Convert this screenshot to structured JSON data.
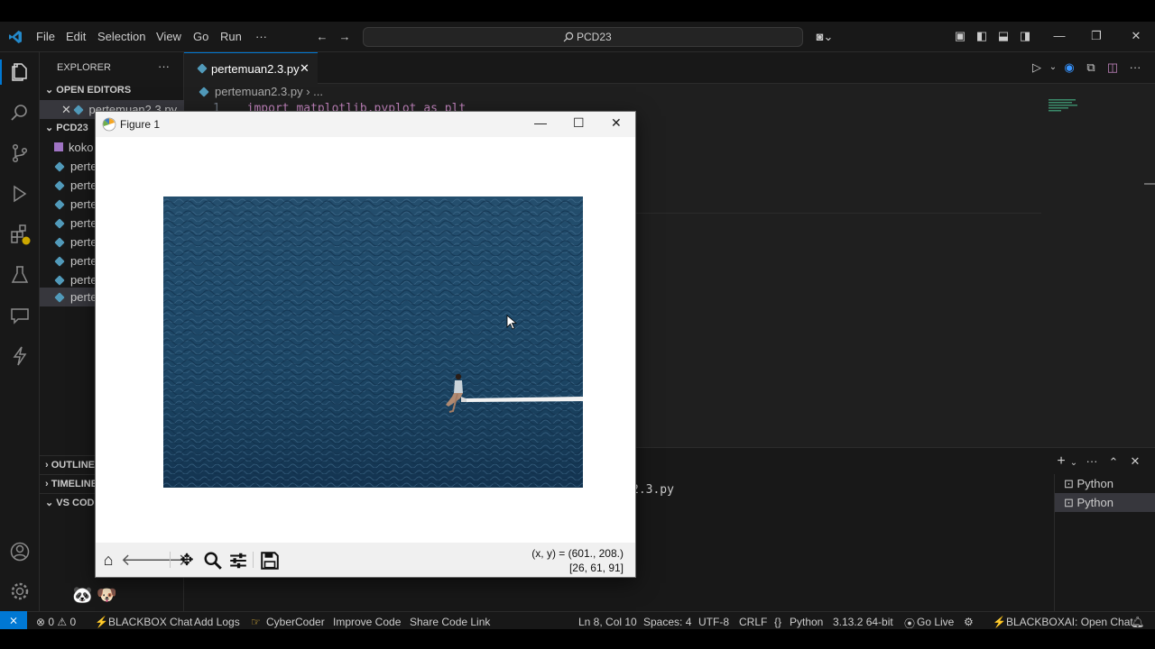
{
  "menu": {
    "items": [
      "File",
      "Edit",
      "Selection",
      "View",
      "Go",
      "Run",
      "···"
    ],
    "search_text": "PCD23"
  },
  "sidebar": {
    "title": "EXPLORER",
    "more": "···",
    "open_editors_label": "OPEN EDITORS",
    "open_editor_file": "pertemuan2.3.py",
    "folder_label": "PCD23",
    "files": [
      "koko",
      "perte",
      "perte",
      "perte",
      "perte",
      "perte",
      "perte",
      "perte",
      "perte"
    ],
    "outline_label": "OUTLINE",
    "timeline_label": "TIMELINE",
    "vscode_label": "VS CODE"
  },
  "editor": {
    "tab_label": "pertemuan2.3.py",
    "breadcrumb_file": "pertemuan2.3.py",
    "breadcrumb_more": "...",
    "line_number": "1",
    "code_line": "import matplotlib.pyplot as plt"
  },
  "panel": {
    "terminal_fragment": "2.3.py",
    "terminals": [
      "Python",
      "Python"
    ]
  },
  "figure": {
    "title": "Figure 1",
    "coord_line1": "(x, y) = (601., 208.)",
    "coord_line2": "[26, 61, 91]"
  },
  "status": {
    "remote": "⨯",
    "problems": "⊗ 0 ⚠ 0",
    "blackbox_chat": "BLACKBOX Chat",
    "add_logs": "Add Logs",
    "cybercoder": "CyberCoder",
    "improve_code": "Improve Code",
    "share_code_link": "Share Code Link",
    "position": "Ln 8, Col 10",
    "spaces": "Spaces: 4",
    "encoding": "UTF-8",
    "eol": "CRLF",
    "language": "Python",
    "interpreter": "3.13.2 64-bit",
    "go_live": "Go Live",
    "blackboxai": "BLACKBOXAI: Open Chat"
  },
  "colors": {
    "accent": "#0078d4",
    "python_icon": "#519aba",
    "sea": "#1f4a6a"
  }
}
